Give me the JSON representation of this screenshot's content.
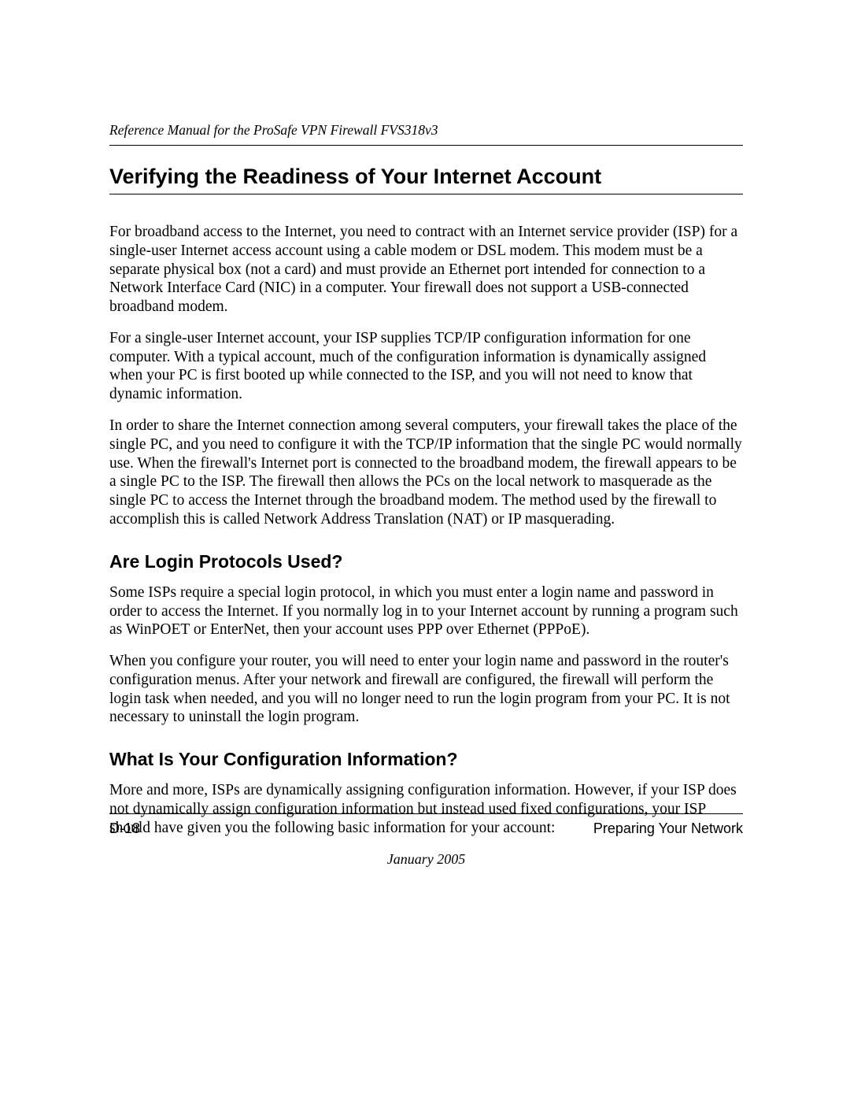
{
  "header": {
    "running_head": "Reference Manual for the ProSafe VPN Firewall FVS318v3"
  },
  "sections": {
    "h1": "Verifying the Readiness of Your Internet Account",
    "p1": "For broadband access to the Internet, you need to contract with an Internet service provider (ISP) for a single-user Internet access account using a cable modem or DSL modem. This modem must be a separate physical box (not a card) and must provide an Ethernet port intended for connection to a Network Interface Card (NIC) in a computer. Your firewall does not support a USB-connected broadband modem.",
    "p2": "For a single-user Internet account, your ISP supplies TCP/IP configuration information for one computer. With a typical account, much of the configuration information is dynamically assigned when your PC is first booted up while connected to the ISP, and you will not need to know that dynamic information.",
    "p3": "In order to share the Internet connection among several computers, your firewall takes the place of the single PC, and you need to configure it with the TCP/IP information that the single PC would normally use. When the firewall's Internet port is connected to the broadband modem, the firewall appears to be a single PC to the ISP. The firewall then allows the PCs on the local network to masquerade as the single PC to access the Internet through the broadband modem. The method used by the firewall to accomplish this is called Network Address Translation (NAT) or IP masquerading.",
    "h2a": "Are Login Protocols Used?",
    "p4": "Some ISPs require a special login protocol, in which you must enter a login name and password in order to access the Internet. If you normally log in to your Internet account by running a program such as WinPOET or EnterNet, then your account uses PPP over Ethernet (PPPoE).",
    "p5": "When you configure your router, you will need to enter your login name and password in the router's configuration menus. After your network and firewall are configured, the firewall will perform the login task when needed, and you will no longer need to run the login program from your PC. It is not necessary to uninstall the login program.",
    "h2b": "What Is Your Configuration Information?",
    "p6": "More and more, ISPs are dynamically assigning configuration information. However, if your ISP does not dynamically assign configuration information but instead used fixed configurations, your ISP should have given you the following basic information for your account:"
  },
  "footer": {
    "page_number": "D-18",
    "section_label": "Preparing Your Network",
    "date": "January 2005"
  }
}
